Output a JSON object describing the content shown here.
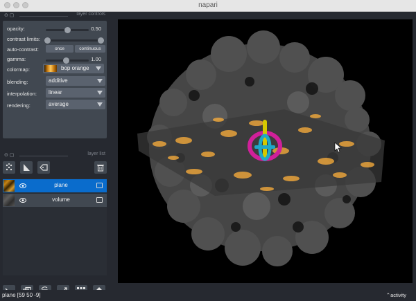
{
  "window": {
    "title": "napari"
  },
  "layer_controls": {
    "header_title": "layer controls",
    "opacity": {
      "label": "opacity:",
      "value": "0.50"
    },
    "contrast_limits": {
      "label": "contrast limits:"
    },
    "auto_contrast": {
      "label": "auto-contrast:",
      "once_label": "once",
      "continuous_label": "continuous"
    },
    "gamma": {
      "label": "gamma:",
      "value": "1.00"
    },
    "colormap": {
      "label": "colormap:",
      "value": "bop orange"
    },
    "blending": {
      "label": "blending:",
      "value": "additive"
    },
    "interpolation": {
      "label": "interpolation:",
      "value": "linear"
    },
    "rendering": {
      "label": "rendering:",
      "value": "average"
    }
  },
  "layer_list": {
    "header_title": "layer list",
    "layers": [
      {
        "name": "plane",
        "selected": true,
        "visible": true
      },
      {
        "name": "volume",
        "selected": false,
        "visible": true
      }
    ]
  },
  "status": {
    "text": "plane [59 50 -9]",
    "activity_label": "activity"
  },
  "colors": {
    "background": "#262930",
    "panel": "#414851",
    "selected": "#0a6ccc",
    "accent_orange": "#ffb13b",
    "axis_magenta": "#d0209a",
    "axis_yellow": "#d4c800",
    "axis_cyan": "#1fa8c8"
  }
}
